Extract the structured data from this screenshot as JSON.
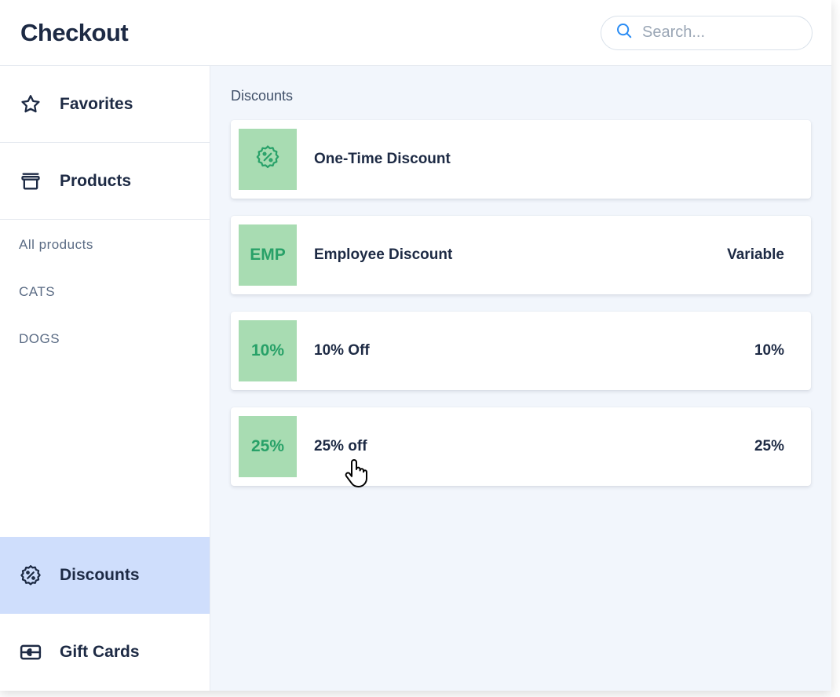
{
  "header": {
    "title": "Checkout",
    "search_placeholder": "Search..."
  },
  "sidebar": {
    "favorites_label": "Favorites",
    "products_label": "Products",
    "product_subitems": [
      "All products",
      "CATS",
      "DOGS"
    ],
    "discounts_label": "Discounts",
    "giftcards_label": "Gift Cards"
  },
  "main": {
    "section_title": "Discounts",
    "discounts": [
      {
        "badge_type": "icon",
        "badge_text": "",
        "name": "One-Time Discount",
        "value": ""
      },
      {
        "badge_type": "text",
        "badge_text": "EMP",
        "name": "Employee Discount",
        "value": "Variable"
      },
      {
        "badge_type": "text",
        "badge_text": "10%",
        "name": "10% Off",
        "value": "10%"
      },
      {
        "badge_type": "text",
        "badge_text": "25%",
        "name": "25% off",
        "value": "25%"
      }
    ]
  }
}
